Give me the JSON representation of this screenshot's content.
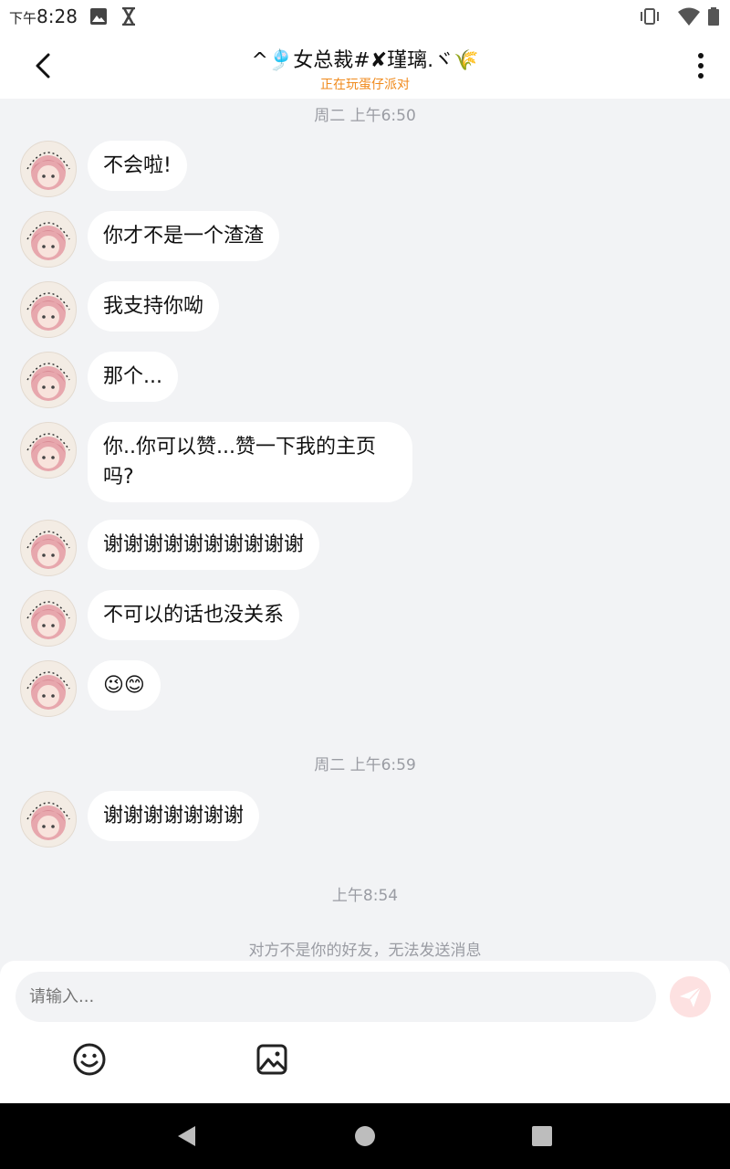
{
  "status_bar": {
    "am_pm": "下午",
    "time": "8:28",
    "icons": [
      "image-icon",
      "hourglass-icon",
      "vibrate-icon",
      "wifi-icon",
      "battery-icon"
    ]
  },
  "header": {
    "title": "^🎐女总裁#✘瑾璃.ヾ🌾",
    "subtitle": "正在玩蛋仔派对",
    "icons": [
      "back-arrow-icon",
      "more-vertical-icon"
    ]
  },
  "chat": {
    "timestamps": [
      "周二 上午6:50",
      "周二 上午6:59",
      "上午8:54"
    ],
    "messages": [
      {
        "text": "不会啦!"
      },
      {
        "text": "你才不是一个渣渣"
      },
      {
        "text": "我支持你呦"
      },
      {
        "text": "那个..."
      },
      {
        "text": "你..你可以赞...赞一下我的主页吗?"
      },
      {
        "text": "谢谢谢谢谢谢谢谢谢谢"
      },
      {
        "text": "不可以的话也没关系"
      },
      {
        "text": "😉😊"
      },
      {
        "text": "谢谢谢谢谢谢谢"
      }
    ],
    "notice": "对方不是你的好友，无法发送消息"
  },
  "input": {
    "placeholder": "请输入...",
    "icons": [
      "send-icon",
      "emoji-icon",
      "image-icon"
    ]
  },
  "nav_bar": {
    "icons": [
      "back-triangle-icon",
      "home-circle-icon",
      "recents-square-icon"
    ]
  },
  "colors": {
    "accent_orange": "#f08a1c",
    "background": "#f2f3f5",
    "bubble": "#ffffff",
    "send_disabled": "#fde1e1"
  }
}
